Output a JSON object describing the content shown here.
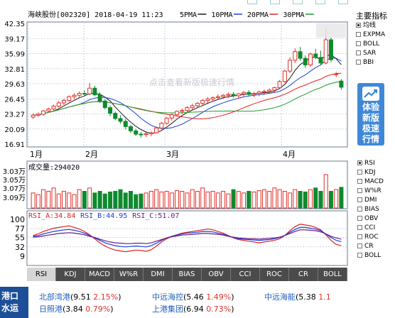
{
  "header": {
    "stock_line": "海峡股份[002320] 2018-04-19 11:23",
    "ma": [
      {
        "label": "5PMA",
        "color": "#1a1a1a"
      },
      {
        "label": "10PMA",
        "color": "#1a3fd6"
      },
      {
        "label": "20PMA",
        "color": "#e02222"
      },
      {
        "label": "30PMA",
        "color": "#1f9e2c"
      }
    ]
  },
  "watermark": "点击查看新版极速行情",
  "price_axis": [
    "42.35",
    "39.17",
    "35.99",
    "32.81",
    "29.63",
    "26.45",
    "23.27",
    "20.09",
    "16.91"
  ],
  "month_labels": [
    "1月",
    "2月",
    "3月",
    "4月"
  ],
  "volume": {
    "title": "成交量:294020",
    "axis": [
      "3.03万",
      "3.05万",
      "3.07万",
      "3.09万"
    ]
  },
  "rsi": {
    "legend": [
      {
        "label": "RSI_A:34.84",
        "color": "#e02222"
      },
      {
        "label": "RSI_B:44.95",
        "color": "#1a3fd6"
      },
      {
        "label": "RSI_C:51.07",
        "color": "#6a1a8a"
      }
    ],
    "axis": [
      "100",
      "77",
      "55",
      "32",
      "9"
    ]
  },
  "side_panel": {
    "title": "主要指标",
    "main_options": [
      {
        "label": "均线",
        "checked": true
      },
      {
        "label": "EXPMA",
        "checked": false
      },
      {
        "label": "BOLL",
        "checked": false
      },
      {
        "label": "SAR",
        "checked": false
      },
      {
        "label": "BBI",
        "checked": false
      }
    ],
    "promo": "体验新版极速行情",
    "promo_lines": [
      "体验",
      "新版",
      "极速",
      "行情"
    ],
    "indicator_options": [
      {
        "label": "RSI",
        "checked": true
      },
      {
        "label": "KDJ",
        "checked": false
      },
      {
        "label": "MACD",
        "checked": false
      },
      {
        "label": "W%R",
        "checked": false
      },
      {
        "label": "DMI",
        "checked": false
      },
      {
        "label": "BIAS",
        "checked": false
      },
      {
        "label": "OBV",
        "checked": false
      },
      {
        "label": "CCI",
        "checked": false
      },
      {
        "label": "ROC",
        "checked": false
      },
      {
        "label": "CR",
        "checked": false
      },
      {
        "label": "BOLL",
        "checked": false
      }
    ]
  },
  "tabs": [
    "RSI",
    "KDJ",
    "MACD",
    "W%R",
    "DMI",
    "BIAS",
    "OBV",
    "CCI",
    "ROC",
    "CR",
    "BOLL"
  ],
  "active_tab": "RSI",
  "ticker": {
    "heading_lines": [
      "港口",
      "水运"
    ],
    "items": [
      {
        "name": "北部湾港",
        "price": "9.51",
        "pct": "2.15%"
      },
      {
        "name": "中远海控",
        "price": "5.46",
        "pct": "1.49%"
      },
      {
        "name": "中远海能",
        "price": "5.38",
        "pct": "1.1"
      },
      {
        "name": "日照港",
        "price": "3.84",
        "pct": "0.79%"
      },
      {
        "name": "上港集团",
        "price": "6.94",
        "pct": "0.73%"
      }
    ]
  },
  "colors": {
    "up": "#e0302a",
    "down": "#0e8a2e",
    "grid": "#b9c7d8",
    "accent": "#3f88d8"
  },
  "chart_data": [
    {
      "type": "candlestick",
      "title": "海峡股份[002320]",
      "ylim": [
        16.91,
        42.35
      ],
      "y_ticks": [
        42.35,
        39.17,
        35.99,
        32.81,
        29.63,
        26.45,
        23.27,
        20.09,
        16.91
      ],
      "x_labels": [
        "1月",
        "2月",
        "3月",
        "4月"
      ],
      "candles": [
        [
          22.6,
          23.4,
          22.2,
          23.0
        ],
        [
          23.0,
          23.6,
          22.7,
          23.2
        ],
        [
          23.2,
          24.1,
          22.9,
          23.9
        ],
        [
          23.9,
          24.6,
          23.5,
          24.3
        ],
        [
          24.3,
          25.2,
          24.0,
          24.9
        ],
        [
          24.9,
          26.0,
          24.6,
          25.6
        ],
        [
          25.6,
          26.5,
          25.1,
          26.1
        ],
        [
          26.1,
          27.2,
          25.8,
          26.9
        ],
        [
          26.9,
          27.6,
          26.4,
          27.2
        ],
        [
          27.2,
          28.0,
          26.8,
          27.6
        ],
        [
          27.6,
          28.2,
          27.0,
          27.5
        ],
        [
          27.5,
          29.8,
          27.2,
          28.7
        ],
        [
          28.7,
          29.2,
          27.0,
          27.3
        ],
        [
          27.3,
          27.8,
          25.6,
          26.0
        ],
        [
          26.0,
          26.4,
          24.2,
          24.6
        ],
        [
          24.6,
          25.0,
          22.8,
          23.4
        ],
        [
          23.4,
          23.8,
          21.9,
          22.3
        ],
        [
          22.3,
          23.0,
          21.2,
          21.7
        ],
        [
          21.7,
          22.2,
          20.0,
          20.6
        ],
        [
          20.6,
          21.0,
          19.2,
          19.7
        ],
        [
          19.7,
          20.1,
          18.6,
          19.0
        ],
        [
          19.0,
          19.5,
          18.3,
          18.9
        ],
        [
          18.9,
          19.4,
          18.4,
          19.1
        ],
        [
          19.1,
          19.6,
          18.6,
          19.3
        ],
        [
          19.3,
          20.6,
          19.1,
          20.3
        ],
        [
          20.3,
          21.6,
          20.0,
          21.3
        ],
        [
          21.3,
          22.6,
          21.0,
          22.4
        ],
        [
          22.4,
          23.4,
          21.9,
          23.1
        ],
        [
          23.1,
          24.0,
          22.7,
          23.8
        ],
        [
          23.8,
          24.4,
          23.2,
          24.0
        ],
        [
          24.0,
          24.9,
          23.6,
          24.6
        ],
        [
          24.6,
          25.4,
          24.1,
          25.0
        ],
        [
          25.0,
          25.8,
          24.5,
          25.5
        ],
        [
          25.5,
          26.4,
          25.1,
          26.1
        ],
        [
          26.1,
          26.8,
          25.6,
          26.4
        ],
        [
          26.4,
          27.0,
          25.9,
          26.7
        ],
        [
          26.7,
          27.4,
          26.2,
          26.9
        ],
        [
          26.9,
          27.5,
          26.4,
          27.2
        ],
        [
          27.2,
          27.8,
          26.6,
          27.4
        ],
        [
          27.4,
          27.9,
          26.7,
          27.1
        ],
        [
          27.1,
          27.7,
          26.5,
          27.5
        ],
        [
          27.5,
          28.1,
          27.0,
          27.8
        ],
        [
          27.8,
          28.3,
          27.1,
          27.4
        ],
        [
          27.4,
          27.9,
          26.8,
          27.6
        ],
        [
          27.6,
          28.2,
          27.0,
          27.9
        ],
        [
          27.9,
          28.4,
          27.3,
          28.0
        ],
        [
          28.0,
          28.6,
          27.5,
          28.3
        ],
        [
          28.3,
          29.0,
          27.8,
          28.8
        ],
        [
          28.8,
          30.4,
          28.5,
          30.1
        ],
        [
          30.1,
          32.6,
          29.8,
          32.3
        ],
        [
          32.3,
          35.2,
          31.9,
          34.6
        ],
        [
          34.6,
          37.1,
          34.0,
          36.4
        ],
        [
          36.4,
          37.4,
          34.5,
          35.0
        ],
        [
          35.0,
          35.6,
          33.0,
          33.6
        ],
        [
          33.6,
          36.2,
          33.2,
          35.9
        ],
        [
          35.9,
          37.0,
          34.8,
          35.2
        ],
        [
          35.2,
          36.6,
          33.5,
          34.0
        ],
        [
          34.0,
          41.6,
          33.7,
          38.9
        ],
        [
          38.9,
          39.5,
          34.2,
          34.7
        ],
        [
          31.6,
          32.1,
          31.0,
          31.7
        ],
        [
          30.2,
          30.6,
          28.4,
          28.9
        ]
      ],
      "ma_series": [
        {
          "name": "5PMA",
          "color": "#1a1a1a"
        },
        {
          "name": "10PMA",
          "color": "#1a3fd6"
        },
        {
          "name": "20PMA",
          "color": "#e02222"
        },
        {
          "name": "30PMA",
          "color": "#1f9e2c"
        }
      ]
    },
    {
      "type": "bar",
      "title": "成交量:294020",
      "y_ticks": [
        "3.03万",
        "3.05万",
        "3.07万",
        "3.09万"
      ],
      "values": [
        0.45,
        0.4,
        0.55,
        0.5,
        0.6,
        0.42,
        0.5,
        0.45,
        0.4,
        0.55,
        0.5,
        0.6,
        0.45,
        0.5,
        0.42,
        0.48,
        0.5,
        0.55,
        0.45,
        0.5,
        0.4,
        0.42,
        0.45,
        0.5,
        0.55,
        0.48,
        0.5,
        0.45,
        0.52,
        0.5,
        0.45,
        0.55,
        0.5,
        0.6,
        0.48,
        0.5,
        0.45,
        0.5,
        0.42,
        0.55,
        0.5,
        0.45,
        0.5,
        0.48,
        0.52,
        0.55,
        0.5,
        0.6,
        0.55,
        0.5,
        0.45,
        0.55,
        0.5,
        0.48,
        0.55,
        0.6,
        0.5,
        1.0,
        0.5,
        0.55,
        0.62
      ]
    },
    {
      "type": "line",
      "title": "RSI",
      "y_ticks": [
        100,
        77,
        55,
        32,
        9
      ],
      "ylim": [
        0,
        110
      ],
      "series": [
        {
          "name": "RSI_A:34.84",
          "color": "#e02222",
          "values": [
            60,
            64,
            70,
            74,
            78,
            80,
            82,
            84,
            80,
            76,
            70,
            62,
            52,
            42,
            34,
            28,
            24,
            22,
            20,
            22,
            24,
            23,
            21,
            25,
            34,
            44,
            52,
            58,
            62,
            66,
            68,
            70,
            72,
            74,
            76,
            74,
            70,
            66,
            60,
            54,
            50,
            48,
            46,
            44,
            42,
            44,
            46,
            48,
            52,
            60,
            72,
            82,
            88,
            86,
            84,
            80,
            74,
            62,
            48,
            38,
            34.84
          ]
        },
        {
          "name": "RSI_B:44.95",
          "color": "#1a3fd6",
          "values": [
            58,
            60,
            64,
            67,
            70,
            72,
            74,
            75,
            73,
            70,
            66,
            60,
            54,
            48,
            42,
            38,
            35,
            33,
            32,
            33,
            34,
            33,
            32,
            35,
            41,
            48,
            54,
            58,
            61,
            64,
            66,
            67,
            68,
            70,
            70,
            69,
            66,
            63,
            59,
            55,
            52,
            51,
            50,
            49,
            48,
            49,
            50,
            52,
            55,
            60,
            68,
            75,
            80,
            80,
            78,
            76,
            72,
            64,
            55,
            48,
            44.95
          ]
        },
        {
          "name": "RSI_C:51.07",
          "color": "#6a1a8a",
          "values": [
            56,
            57,
            59,
            61,
            63,
            65,
            66,
            67,
            66,
            64,
            62,
            58,
            55,
            51,
            47,
            44,
            42,
            41,
            40,
            40,
            41,
            41,
            40,
            42,
            46,
            50,
            54,
            57,
            59,
            61,
            62,
            63,
            64,
            65,
            65,
            64,
            63,
            61,
            58,
            56,
            54,
            53,
            52,
            52,
            51,
            52,
            53,
            54,
            56,
            60,
            65,
            70,
            74,
            74,
            73,
            72,
            69,
            64,
            58,
            54,
            51.07
          ]
        }
      ]
    }
  ]
}
